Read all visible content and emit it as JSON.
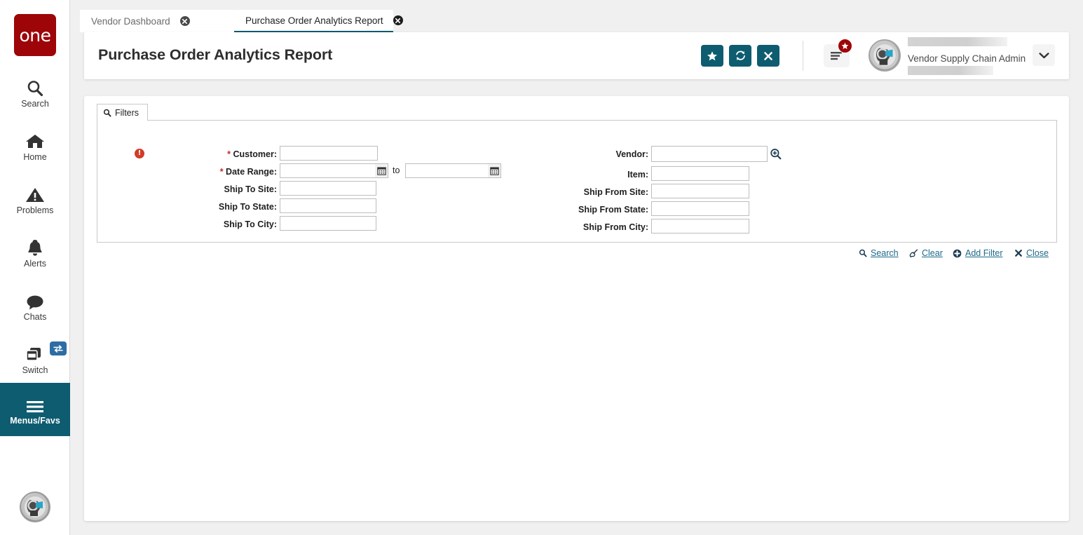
{
  "app": {
    "logo_text": "one",
    "accent_teal": "#0e5c70",
    "brand_red": "#9d0509",
    "link_color": "#1b6a8a",
    "required_color": "#c32a2a"
  },
  "sidebar": {
    "items": [
      {
        "label": "Search",
        "icon": "search-icon",
        "active": false
      },
      {
        "label": "Home",
        "icon": "home-icon",
        "active": false
      },
      {
        "label": "Problems",
        "icon": "warning-icon",
        "active": false
      },
      {
        "label": "Alerts",
        "icon": "bell-icon",
        "active": false
      },
      {
        "label": "Chats",
        "icon": "chat-icon",
        "active": false
      },
      {
        "label": "Switch",
        "icon": "switch-icon",
        "active": false
      },
      {
        "label": "Menus/Favs",
        "icon": "hamburger-icon",
        "active": true
      }
    ],
    "bottom_avatar_icon": "user-avatar-icon"
  },
  "tabs": [
    {
      "label": "Vendor Dashboard",
      "active": false,
      "close_icon": "close-circle-icon"
    },
    {
      "label": "Purchase Order Analytics Report",
      "active": true,
      "close_icon": "close-circle-icon"
    }
  ],
  "header": {
    "title": "Purchase Order Analytics Report",
    "buttons": [
      {
        "name": "favorite-button",
        "icon": "star-icon"
      },
      {
        "name": "refresh-button",
        "icon": "refresh-icon"
      },
      {
        "name": "close-button",
        "icon": "x-icon"
      }
    ],
    "menu": {
      "icon": "menu-lines-icon",
      "badge_icon": "star-icon"
    },
    "user": {
      "avatar_icon": "user-avatar-icon",
      "name": "Vendor Supply Chain Admin",
      "caret_icon": "chevron-down-icon"
    }
  },
  "filters": {
    "tab_label": "Filters",
    "tab_icon": "search-icon",
    "left_fields": [
      {
        "label": "Customer",
        "required": true,
        "error": true,
        "value": "",
        "placeholder": "",
        "type": "text"
      },
      {
        "label": "Date Range",
        "required": true,
        "error": false,
        "value": "",
        "placeholder": "",
        "type": "daterange",
        "separator": "to",
        "value_to": ""
      },
      {
        "label": "Ship To Site",
        "required": false,
        "error": false,
        "value": "",
        "placeholder": "",
        "type": "text"
      },
      {
        "label": "Ship To State",
        "required": false,
        "error": false,
        "value": "",
        "placeholder": "",
        "type": "text"
      },
      {
        "label": "Ship To City",
        "required": false,
        "error": false,
        "value": "",
        "placeholder": "",
        "type": "text"
      }
    ],
    "right_fields": [
      {
        "label": "Vendor",
        "required": false,
        "value": "",
        "placeholder": "",
        "type": "picker",
        "picker_icon": "magnifier-plus-icon"
      },
      {
        "label": "Item",
        "required": false,
        "value": "",
        "placeholder": "",
        "type": "text"
      },
      {
        "label": "Ship From Site",
        "required": false,
        "value": "",
        "placeholder": "",
        "type": "text"
      },
      {
        "label": "Ship From State",
        "required": false,
        "value": "",
        "placeholder": "",
        "type": "text"
      },
      {
        "label": "Ship From City",
        "required": false,
        "value": "",
        "placeholder": "",
        "type": "text"
      }
    ],
    "actions": [
      {
        "label": "Search",
        "icon": "search-icon"
      },
      {
        "label": "Clear",
        "icon": "broom-icon"
      },
      {
        "label": "Add Filter",
        "icon": "plus-circle-icon"
      },
      {
        "label": "Close",
        "icon": "x-icon"
      }
    ]
  }
}
